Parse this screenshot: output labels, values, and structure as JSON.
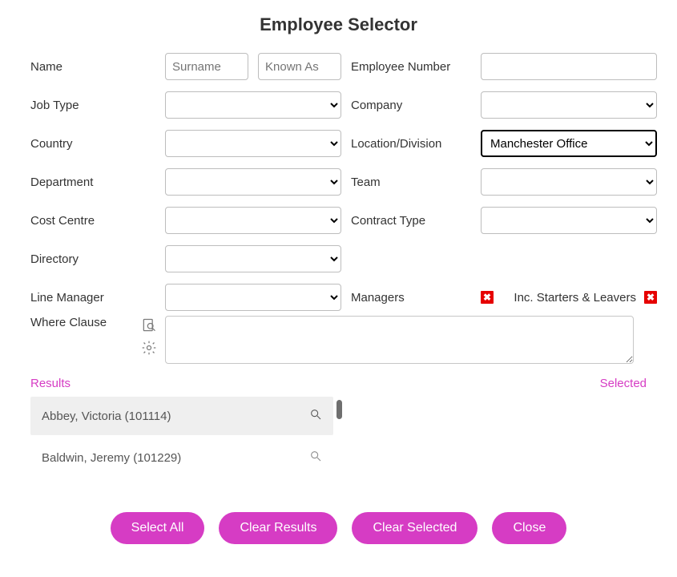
{
  "title": "Employee Selector",
  "labels": {
    "name": "Name",
    "employee_number": "Employee Number",
    "job_type": "Job Type",
    "company": "Company",
    "country": "Country",
    "location_division": "Location/Division",
    "department": "Department",
    "team": "Team",
    "cost_centre": "Cost Centre",
    "contract_type": "Contract Type",
    "directory": "Directory",
    "line_manager": "Line Manager",
    "managers": "Managers",
    "inc_starters_leavers": "Inc. Starters & Leavers",
    "where_clause": "Where Clause",
    "results": "Results",
    "selected": "Selected"
  },
  "inputs": {
    "surname_placeholder": "Surname",
    "known_as_placeholder": "Known As",
    "employee_number_value": "",
    "job_type": "",
    "company": "",
    "country": "",
    "location_division": "Manchester Office",
    "department": "",
    "team": "",
    "cost_centre": "",
    "contract_type": "",
    "directory": "",
    "line_manager": "",
    "where_clause": ""
  },
  "toggles": {
    "managers_badge": "✖",
    "starters_leavers_badge": "✖"
  },
  "results": [
    {
      "display": "Abbey, Victoria (101114)"
    },
    {
      "display": "Baldwin, Jeremy (101229)"
    }
  ],
  "buttons": {
    "select_all": "Select All",
    "clear_results": "Clear Results",
    "clear_selected": "Clear Selected",
    "close": "Close"
  }
}
